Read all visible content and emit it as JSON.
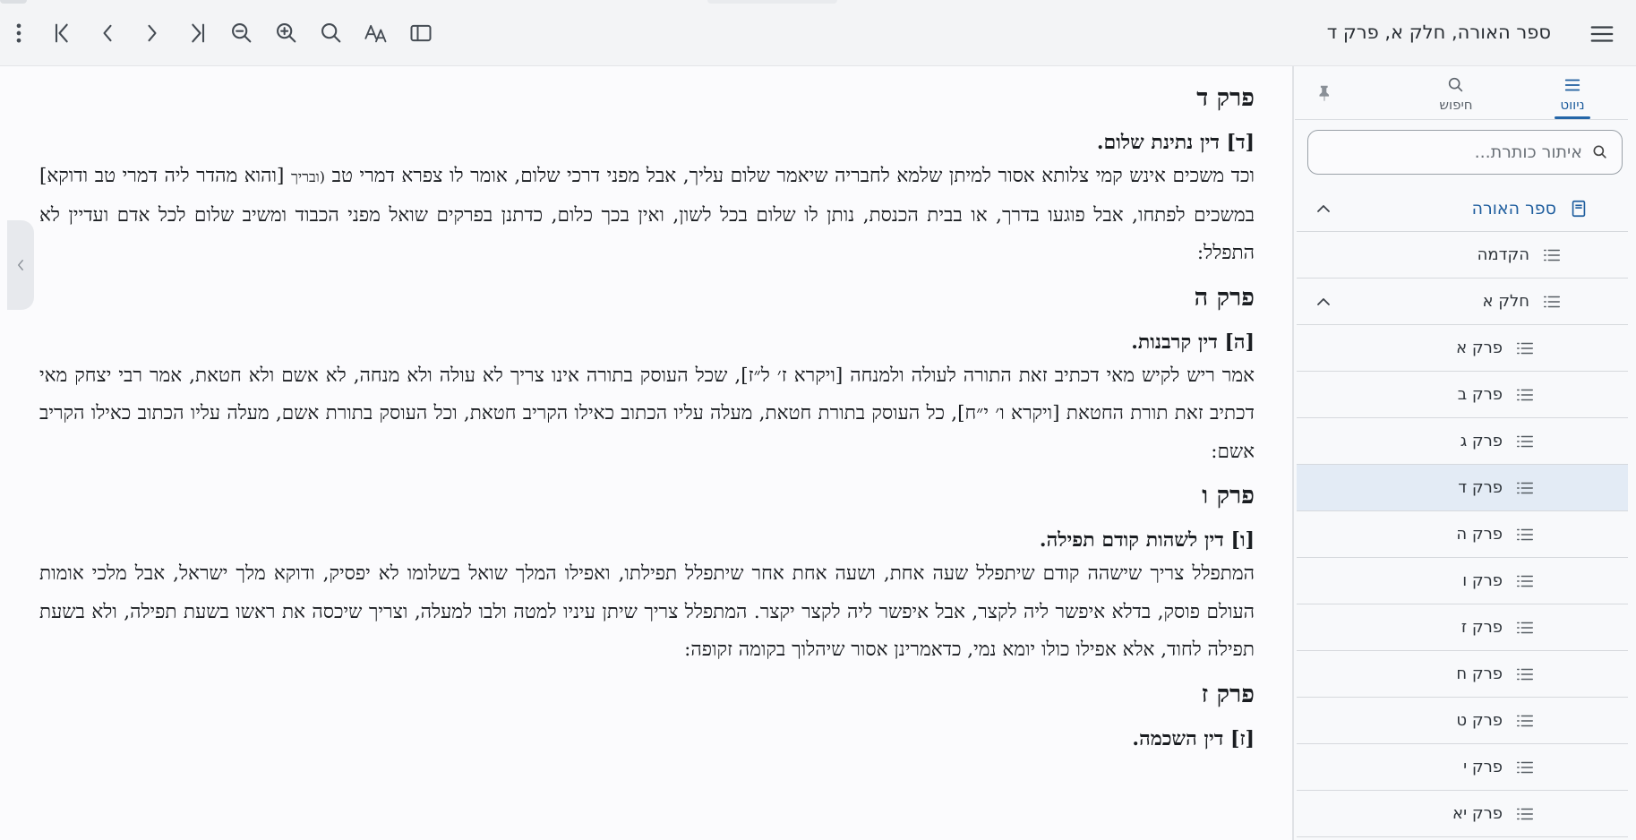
{
  "toolbar": {
    "document_title": "ספר האורה, חלק א, פרק ד",
    "icons": [
      "more-vert-icon",
      "first-page-icon",
      "previous-icon",
      "next-icon",
      "last-page-icon",
      "zoom-out-icon",
      "zoom-in-icon",
      "search-icon",
      "font-icon",
      "sidebar-toggle-icon",
      "menu-icon"
    ]
  },
  "sidebar": {
    "tabs": [
      {
        "label": "ניווט",
        "icon": "list-icon",
        "active": true
      },
      {
        "label": "חיפוש",
        "icon": "search-icon",
        "active": false
      },
      {
        "label": "",
        "icon": "pin-icon",
        "active": false
      }
    ],
    "filter_placeholder": "איתור כותרת...",
    "tree": [
      {
        "label": "ספר האורה",
        "level": 0,
        "type": "book",
        "expanded": true
      },
      {
        "label": "הקדמה",
        "level": 1,
        "type": "item"
      },
      {
        "label": "חלק א",
        "level": 1,
        "type": "item",
        "expanded": true
      },
      {
        "label": "פרק א",
        "level": 2,
        "type": "item"
      },
      {
        "label": "פרק ב",
        "level": 2,
        "type": "item"
      },
      {
        "label": "פרק ג",
        "level": 2,
        "type": "item"
      },
      {
        "label": "פרק ד",
        "level": 2,
        "type": "item",
        "selected": true
      },
      {
        "label": "פרק ה",
        "level": 2,
        "type": "item"
      },
      {
        "label": "פרק ו",
        "level": 2,
        "type": "item"
      },
      {
        "label": "פרק ז",
        "level": 2,
        "type": "item"
      },
      {
        "label": "פרק ח",
        "level": 2,
        "type": "item"
      },
      {
        "label": "פרק ט",
        "level": 2,
        "type": "item"
      },
      {
        "label": "פרק י",
        "level": 2,
        "type": "item"
      },
      {
        "label": "פרק יא",
        "level": 2,
        "type": "item"
      }
    ]
  },
  "content": {
    "sections": [
      {
        "chapter": "פרק ד",
        "heading": "[ד] דין נתינת שלום.",
        "text_before_small": "וכד משכים אינש קמי צלותא אסור למיתן שלמא לחבריה שיאמר שלום עליך, אבל מפני דרכי שלום, אומר לו צפרא דמרי טב ",
        "small": "(ובריך",
        "text_after_small": " [והוא מהדר ליה דמרי טב ודוקא] במשכים לפתחו, אבל פוגעו בדרך, או בבית הכנסת, נותן לו שלום בכל לשון, ואין בכך כלום, כדתנן בפרקים שואל מפני הכבוד ומשיב שלום לכל אדם ועדיין לא התפלל:"
      },
      {
        "chapter": "פרק ה",
        "heading": "[ה] דין קרבנות.",
        "text": "אמר ריש לקיש מאי דכתיב זאת התורה לעולה ולמנחה [ויקרא ז׳ ל״ז], שכל העוסק בתורה אינו צריך לא עולה ולא מנחה, לא אשם ולא חטאת, אמר רבי יצחק מאי דכתיב זאת תורת החטאת [ויקרא ו׳ י״ח], כל העוסק בתורת חטאת, מעלה עליו הכתוב כאילו הקריב חטאת, וכל העוסק בתורת אשם, מעלה עליו הכתוב כאילו הקריב אשם:"
      },
      {
        "chapter": "פרק ו",
        "heading": "[ו] דין לשהות קודם תפילה.",
        "text": "המתפלל צריך שישהה קודם שיתפלל שעה אחת, ושעה אחת אחר שיתפלל תפילתו, ואפילו המלך שואל בשלומו לא יפסיק, ודוקא מלך ישראל, אבל מלכי אומות העולם פוסק, בדלא איפשר ליה לקצר, אבל איפשר ליה לקצר יקצר. המתפלל צריך שיתן עיניו למטה ולבו למעלה, וצריך שיכסה את ראשו בשעת תפילה, ולא בשעת תפילה לחוד, אלא אפילו כולו יומא נמי, כדאמרינן אסור שיהלוך בקומה זקופה:"
      },
      {
        "chapter": "פרק ז",
        "heading": "[ז] דין השכמה."
      }
    ]
  }
}
